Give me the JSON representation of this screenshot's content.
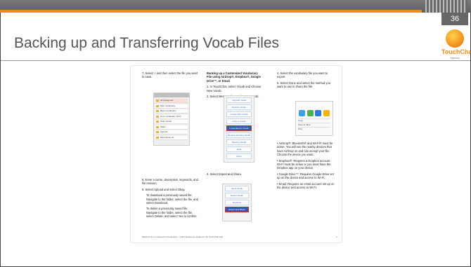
{
  "slide": {
    "title": "Backing up and Transferring Vocab Files",
    "page_number": "36"
  },
  "logo": {
    "name": "TouchChat",
    "sub": "Speech"
  },
  "document": {
    "col1": {
      "step7": "7.  Select + and then select the file you want to save.",
      "step8": "8.  Enter a name, description, keywords, and file revision.",
      "step9": "9.  Select Upload and select Okay.",
      "note1": "To download a previously saved file: Navigate to the folder, select the file, and select Download.",
      "note2": "To delete a previously saved file: Navigate to the folder, select the file, select Delete, and select Yes to confirm.",
      "files": [
        "All Categories",
        "Misc vocabulary",
        "Basic vocabulary",
        "Core vocabulary (first)",
        "Daily Needs",
        "Water",
        "Sample",
        "Miscellaneous"
      ]
    },
    "col2": {
      "heading": "Backing up a Customized Vocabulary File using AirDrop®, Dropbox®, Google Drive™, or Email",
      "step1": "1.  In TouchChat, select Vocab and Choose New Vocab.",
      "step2": "2.  Select Menu and Import/Export Vocab.",
      "step3": "3.  Select Export and Share.",
      "menu": [
        "Upgrade Vocab",
        "Restore Vocab",
        "Create New Vocab",
        "Copy a Vocab",
        "Import/Export Vocab",
        "Rename Existing Vocab",
        "Delete A Vocab",
        "Help",
        "Done"
      ],
      "share": [
        "Send Vocab",
        "Export Vocab",
        "Duplicate",
        "Export and Share"
      ]
    },
    "col3": {
      "step4": "4.  Select the vocabulary file you want to export.",
      "step5": "5.  Select Done and select the method you want to use to share the file.",
      "bullet1": "AirDrop®: Bluetooth® and Wi-Fi® must be active. You will see the nearby devices that have AirDrop on and can accept your file. Choose the device you want.",
      "bullet2": "Dropbox®: Requires a Dropbox account. Wi-Fi must be active or you must have the Dropbox app on your device.",
      "bullet3": "Google Drive™: Requires Google Drive set up on the device and access to Wi-Fi.",
      "bullet4": "Email: Requires an email account set up on the device and access to Wi-Fi.",
      "share_rows": [
        "Copy",
        "Save to Files",
        "Print"
      ]
    },
    "footer_left": "Backing Up a Customized Vocabulary – Quick Reference Guide for the TouchChat App",
    "footer_right": "2"
  },
  "colors": {
    "accent_orange": "#f18a1c",
    "bar_gray": "#666666",
    "title_gray": "#555555"
  }
}
